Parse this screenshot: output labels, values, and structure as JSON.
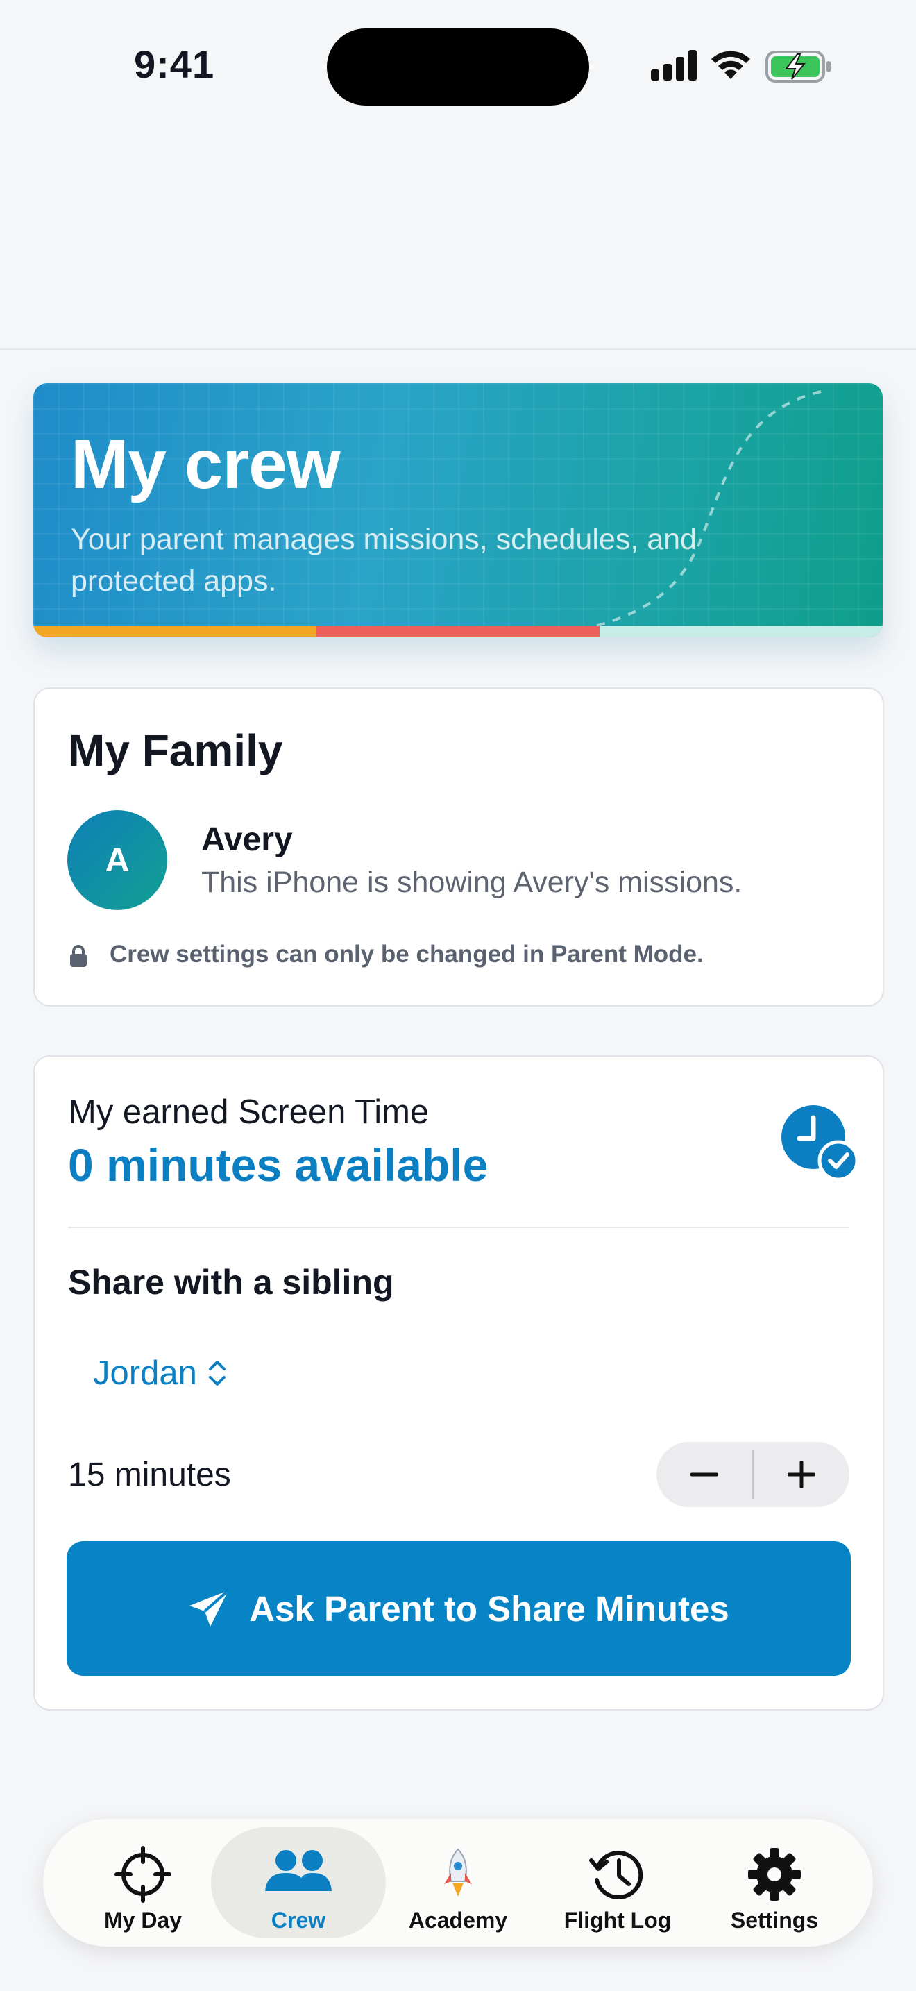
{
  "status_bar": {
    "time": "9:41"
  },
  "hero": {
    "title": "My crew",
    "subtitle": "Your parent manages missions, schedules, and protected apps."
  },
  "family_card": {
    "title": "My Family",
    "member": {
      "initial": "A",
      "name": "Avery",
      "description": "This iPhone is showing Avery's missions."
    },
    "lock_note": "Crew settings can only be changed in Parent Mode."
  },
  "screen_time_card": {
    "label": "My earned Screen Time",
    "value": "0 minutes available",
    "share_title": "Share with a sibling",
    "selected_sibling": "Jordan",
    "share_minutes": "15 minutes",
    "ask_button": "Ask Parent to Share Minutes"
  },
  "tabs": [
    {
      "label": "My Day",
      "icon": "crosshair-icon"
    },
    {
      "label": "Crew",
      "icon": "people-icon",
      "active": true
    },
    {
      "label": "Academy",
      "icon": "rocket-icon"
    },
    {
      "label": "Flight Log",
      "icon": "history-clock-icon"
    },
    {
      "label": "Settings",
      "icon": "gear-icon"
    }
  ],
  "colors": {
    "accent": "#0784c6",
    "hero_start": "#1f8cc9",
    "hero_end": "#0f9e8a",
    "progress_orange": "#f2a724",
    "progress_red": "#ec5f5b"
  }
}
